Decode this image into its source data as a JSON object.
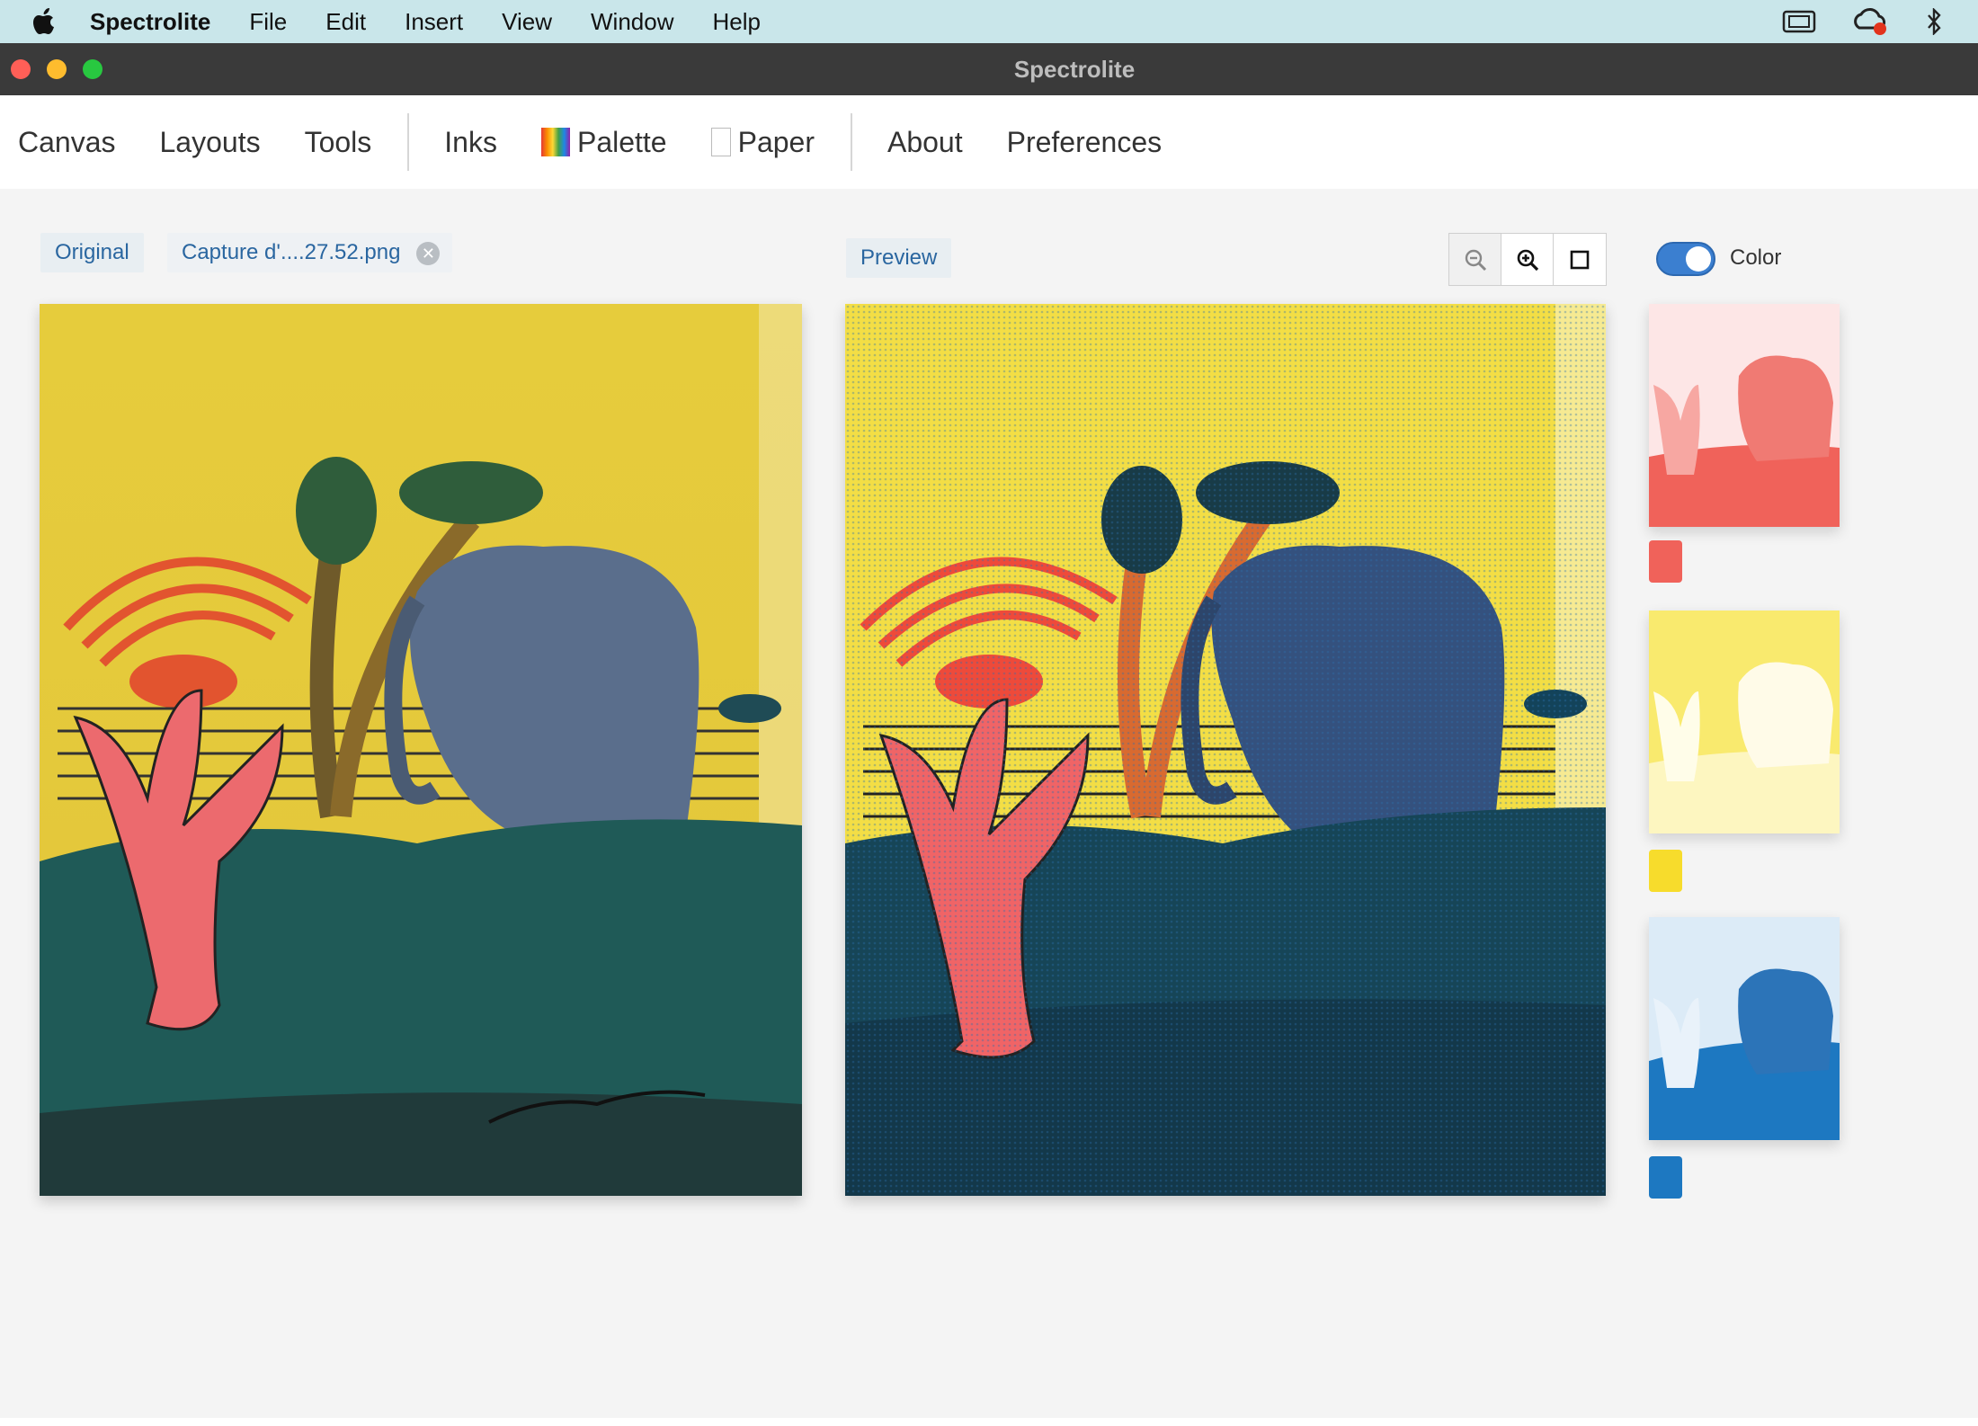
{
  "menubar": {
    "apple_icon": "apple-logo-icon",
    "app_name": "Spectrolite",
    "items": [
      "File",
      "Edit",
      "Insert",
      "View",
      "Window",
      "Help"
    ],
    "status_icons": [
      "screen-mirroring-icon",
      "creative-cloud-icon",
      "bluetooth-icon"
    ]
  },
  "window": {
    "title": "Spectrolite"
  },
  "nav": {
    "group1": [
      "Canvas",
      "Layouts",
      "Tools"
    ],
    "inks": "Inks",
    "palette": "Palette",
    "paper": "Paper",
    "about": "About",
    "preferences": "Preferences"
  },
  "toolbar": {
    "original_label": "Original",
    "file_label": "Capture d'....27.52.png",
    "preview_label": "Preview",
    "color_toggle_label": "Color",
    "color_toggle_on": true,
    "zoom_icons": [
      "zoom-out-icon",
      "zoom-in-icon",
      "fit-frame-icon"
    ]
  },
  "inks": [
    {
      "name": "red",
      "color": "#f0625a"
    },
    {
      "name": "yellow",
      "color": "#f7dc2c"
    },
    {
      "name": "blue",
      "color": "#1d78c1"
    }
  ],
  "colors": {
    "sky": "#e8cf3c",
    "sun": "#e2542f",
    "elephant": "#5a6e8c",
    "grass": "#1f5a57",
    "rabbit": "#ec6a6e",
    "ground_dark": "#203a3a"
  }
}
